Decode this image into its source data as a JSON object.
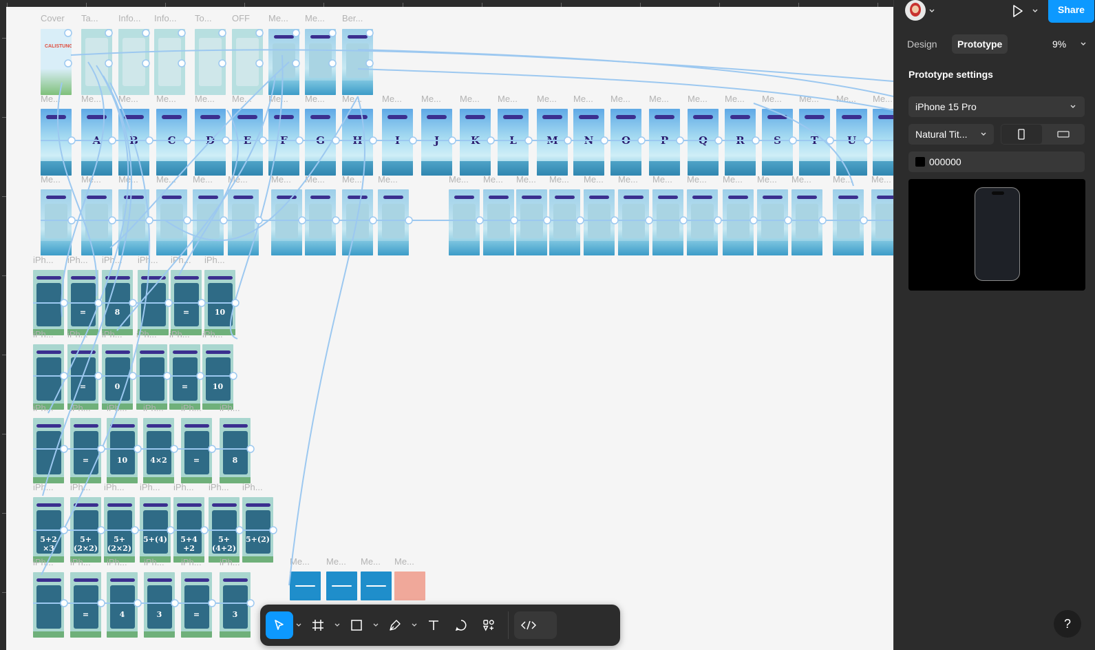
{
  "canvas": {
    "top_row_labels": [
      "Cover",
      "Ta...",
      "Info...",
      "Info...",
      "To...",
      "OFF",
      "Me...",
      "Me...",
      "Ber..."
    ],
    "frame_label_short": "Me...",
    "iphone_label": "iPh...",
    "row2_letters": [
      "A",
      "B",
      "C",
      "D",
      "E",
      "F",
      "G",
      "H",
      "I",
      "J",
      "K",
      "L",
      "M",
      "N",
      "O",
      "P",
      "Q",
      "R",
      "S",
      "T",
      "U"
    ],
    "row4_values": [
      "",
      "=",
      "8",
      "",
      "=",
      "10"
    ],
    "row5_values": [
      "",
      "=",
      "0",
      "",
      "=",
      "10"
    ],
    "row6_values": [
      "",
      "=",
      "10",
      "4×2",
      "=",
      "8"
    ],
    "row7_values": [
      "5+2 ×3",
      "5+(2×2)",
      "5+(2×2)",
      "5+(4)",
      "5+4 +2",
      "5+(4+2)",
      "5+(2)"
    ],
    "row8_values": [
      "",
      "=",
      "4",
      "3",
      "=",
      "3"
    ],
    "cover_title": "CALISTUNG"
  },
  "toolbar": {
    "tools": [
      {
        "name": "move-tool",
        "icon": "cursor-arrow-icon"
      },
      {
        "name": "frame-tool",
        "icon": "hash-frame-icon"
      },
      {
        "name": "shape-tool",
        "icon": "rectangle-icon"
      },
      {
        "name": "pen-tool",
        "icon": "pen-icon"
      },
      {
        "name": "text-tool",
        "icon": "text-t-icon"
      },
      {
        "name": "comment-tool",
        "icon": "speech-bubble-icon"
      },
      {
        "name": "components-tool",
        "icon": "components-icon"
      },
      {
        "name": "dev-mode-toggle",
        "icon": "code-brackets-icon"
      }
    ]
  },
  "panel": {
    "share_label": "Share",
    "tabs": [
      "Design",
      "Prototype"
    ],
    "active_tab": "Prototype",
    "zoom": "9%",
    "settings_title": "Prototype settings",
    "device": "iPhone 15 Pro",
    "device_frame": "Natural Tit...",
    "background_color": "000000",
    "help_label": "?"
  },
  "colors": {
    "accent": "#0d99ff",
    "panel_bg": "#2c2c2c",
    "canvas_bg": "#f5f5f5",
    "wire": "#9cc8f0",
    "frame_sky": "#8fd3ef",
    "frame_sea": "#b3d9d4",
    "frame_dark": "#2f6b86"
  }
}
